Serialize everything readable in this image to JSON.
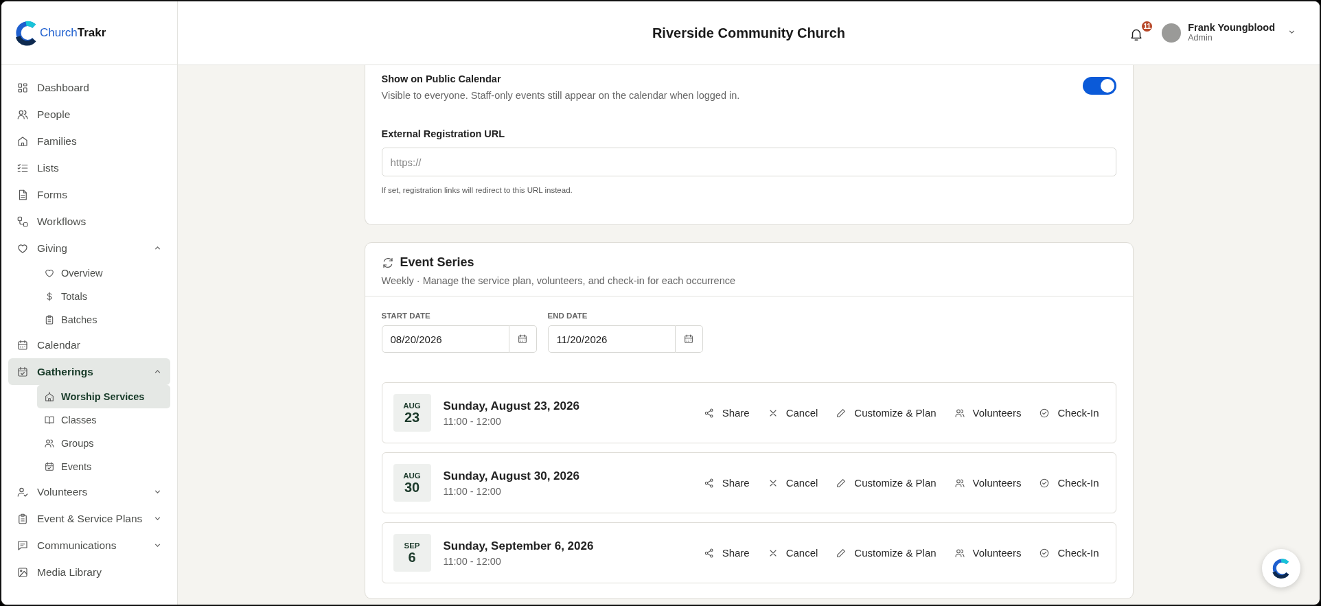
{
  "brand": {
    "name": "Church**Trakr**"
  },
  "header": {
    "title": "Riverside Community Church",
    "notifications": "11",
    "user": {
      "name": "Frank Youngblood",
      "role": "Admin"
    }
  },
  "sidebar": {
    "items": [
      {
        "label": "Dashboard",
        "selected": false
      },
      {
        "label": "People",
        "selected": false
      },
      {
        "label": "Families",
        "selected": false
      },
      {
        "label": "Lists",
        "selected": false
      },
      {
        "label": "Forms",
        "selected": false
      },
      {
        "label": "Workflows",
        "selected": false
      },
      {
        "label": "Giving",
        "selected": false,
        "expanded": true,
        "children": [
          {
            "label": "Overview",
            "selected": false
          },
          {
            "label": "Totals",
            "selected": false
          },
          {
            "label": "Batches",
            "selected": false
          }
        ]
      },
      {
        "label": "Calendar",
        "selected": false
      },
      {
        "label": "Gatherings",
        "selected": true,
        "expanded": true,
        "children": [
          {
            "label": "Worship Services",
            "selected": true
          },
          {
            "label": "Classes",
            "selected": false
          },
          {
            "label": "Groups",
            "selected": false
          },
          {
            "label": "Events",
            "selected": false
          }
        ]
      },
      {
        "label": "Volunteers",
        "selected": false,
        "expanded": false
      },
      {
        "label": "Event & Service Plans",
        "selected": false,
        "expanded": false
      },
      {
        "label": "Communications",
        "selected": false,
        "expanded": false
      },
      {
        "label": "Media Library",
        "selected": false
      }
    ]
  },
  "public_calendar": {
    "label": "Show on Public Calendar",
    "description": "Visible to everyone. Staff-only events still appear on the calendar when logged in.",
    "on": true
  },
  "registration": {
    "label": "External Registration URL",
    "placeholder": "https://",
    "hint": "If set, registration links will redirect to this URL instead."
  },
  "event_series": {
    "title": "Event Series",
    "subtitle": "Weekly · Manage the service plan, volunteers, and check-in for each occurrence",
    "start_date": {
      "label": "START DATE",
      "value": "08/20/2026"
    },
    "end_date": {
      "label": "END DATE",
      "value": "11/20/2026"
    },
    "occurrences": [
      {
        "month": "AUG",
        "day": "23",
        "title": "Sunday, August 23, 2026",
        "time": "11:00 - 12:00",
        "actions": [
          "Share",
          "Cancel",
          "Customize & Plan",
          "Volunteers",
          "Check-In"
        ]
      },
      {
        "month": "AUG",
        "day": "30",
        "title": "Sunday, August 30, 2026",
        "time": "11:00 - 12:00",
        "actions": [
          "Share",
          "Cancel",
          "Customize & Plan",
          "Volunteers",
          "Check-In"
        ]
      },
      {
        "month": "SEP",
        "day": "6",
        "title": "Sunday, September 6, 2026",
        "time": "11:00 - 12:00",
        "actions": [
          "Share",
          "Cancel",
          "Customize & Plan",
          "Volunteers",
          "Check-In"
        ]
      }
    ]
  }
}
